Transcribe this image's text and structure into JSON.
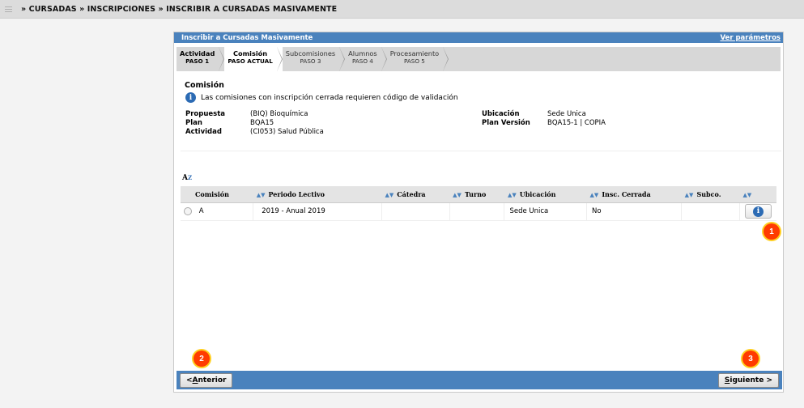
{
  "breadcrumb": "» CURSADAS » INSCRIPCIONES » INSCRIBIR A CURSADAS MASIVAMENTE",
  "panel": {
    "title": "Inscribir a Cursadas Masivamente",
    "params_link": "Ver parámetros"
  },
  "wizard": [
    {
      "name": "Actividad",
      "step": "PASO 1",
      "state": "done"
    },
    {
      "name": "Comisión",
      "step": "PASO ACTUAL",
      "state": "current"
    },
    {
      "name": "Subcomisiones",
      "step": "PASO 3",
      "state": "pending"
    },
    {
      "name": "Alumnos",
      "step": "PASO 4",
      "state": "pending"
    },
    {
      "name": "Procesamiento",
      "step": "PASO 5",
      "state": "pending"
    }
  ],
  "section": {
    "title": "Comisión",
    "info_icon": "i",
    "notice": "Las comisiones con inscripción cerrada requieren código de validación"
  },
  "details": {
    "propuesta_label": "Propuesta",
    "propuesta": "(BIQ) Bioquímica",
    "plan_label": "Plan",
    "plan": "BQA15",
    "actividad_label": "Actividad",
    "actividad": "(CI053) Salud Pública",
    "ubicacion_label": "Ubicación",
    "ubicacion": "Sede Unica",
    "plan_version_label": "Plan Versión",
    "plan_version": "BQA15-1 | COPIA"
  },
  "sort_icon": "AZ",
  "table": {
    "columns": [
      "Comisión",
      "Periodo Lectivo",
      "Cátedra",
      "Turno",
      "Ubicación",
      "Insc. Cerrada",
      "Subco."
    ],
    "rows": [
      {
        "comision": "A",
        "periodo": "2019 - Anual 2019",
        "catedra": "",
        "turno": "",
        "ubicacion": "Sede Unica",
        "insc_cerrada": "No",
        "subco": ""
      }
    ]
  },
  "badges": [
    "1",
    "2",
    "3"
  ],
  "footer": {
    "prev_prefix": "< ",
    "prev_u": "A",
    "prev_rest": "nterior",
    "next_u": "S",
    "next_rest": "iguiente >"
  },
  "colors": {
    "accent": "#4a82bd",
    "badge": "#ff3b00"
  }
}
